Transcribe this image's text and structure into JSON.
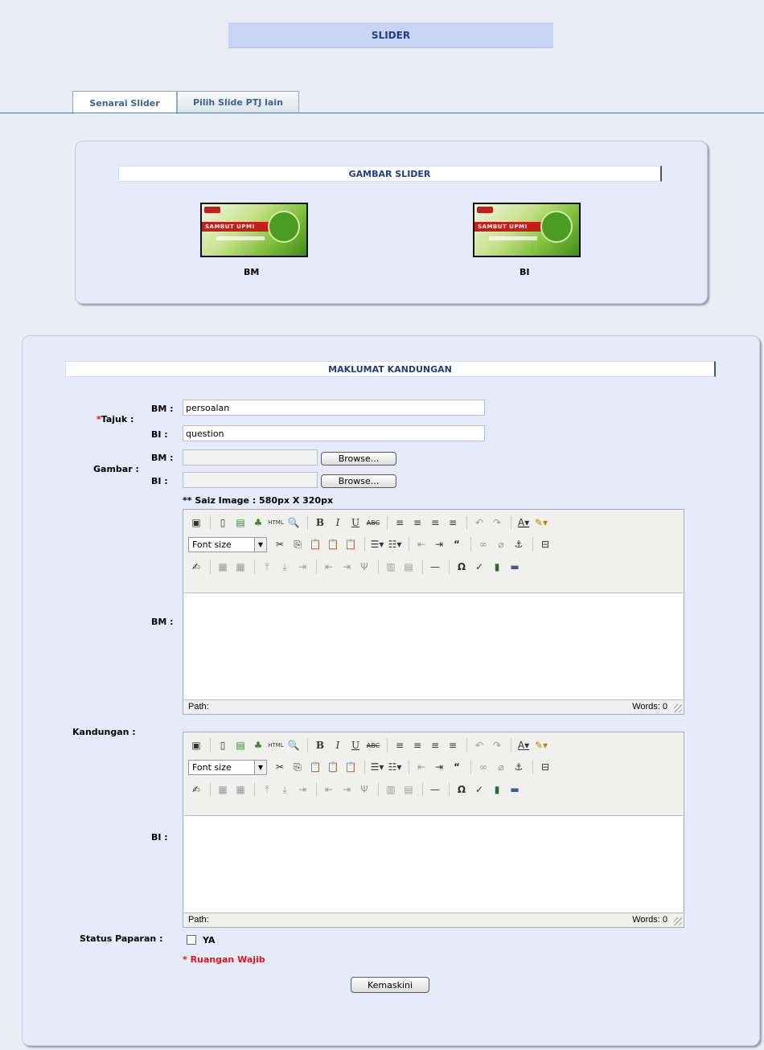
{
  "page": {
    "title": "SLIDER"
  },
  "tabs": [
    {
      "label": "Senarai Slider"
    },
    {
      "label": "Pilih Slide PTJ lain"
    }
  ],
  "gallery": {
    "header": "GAMBAR SLIDER",
    "images": [
      {
        "caption": "BM",
        "banner_text": "SAMBUT UPM!"
      },
      {
        "caption": "BI",
        "banner_text": "SAMBUT UPM!"
      }
    ]
  },
  "form": {
    "header": "MAKLUMAT KANDUNGAN",
    "tajuk_label": "Tajuk :",
    "required_mark": "*",
    "bm_label": "BM :",
    "bi_label": "BI :",
    "tajuk_bm_value": "persoalan",
    "tajuk_bi_value": "question",
    "gambar_label": "Gambar :",
    "browse_label": "Browse...",
    "size_note": "** Saiz Image : 580px X 320px",
    "kandungan_label": "Kandungan :",
    "editor": {
      "font_size_label": "Font size",
      "path_label": "Path:",
      "words_label": "Words: 0"
    },
    "status_label": "Status Paparan :",
    "status_option": "YA",
    "status_checked": false,
    "required_note": "* Ruangan Wajib",
    "submit_label": "Kemaskini"
  },
  "colors": {
    "accent": "#233d82",
    "title_bg": "#c8d3f6",
    "required": "#ee1111"
  }
}
